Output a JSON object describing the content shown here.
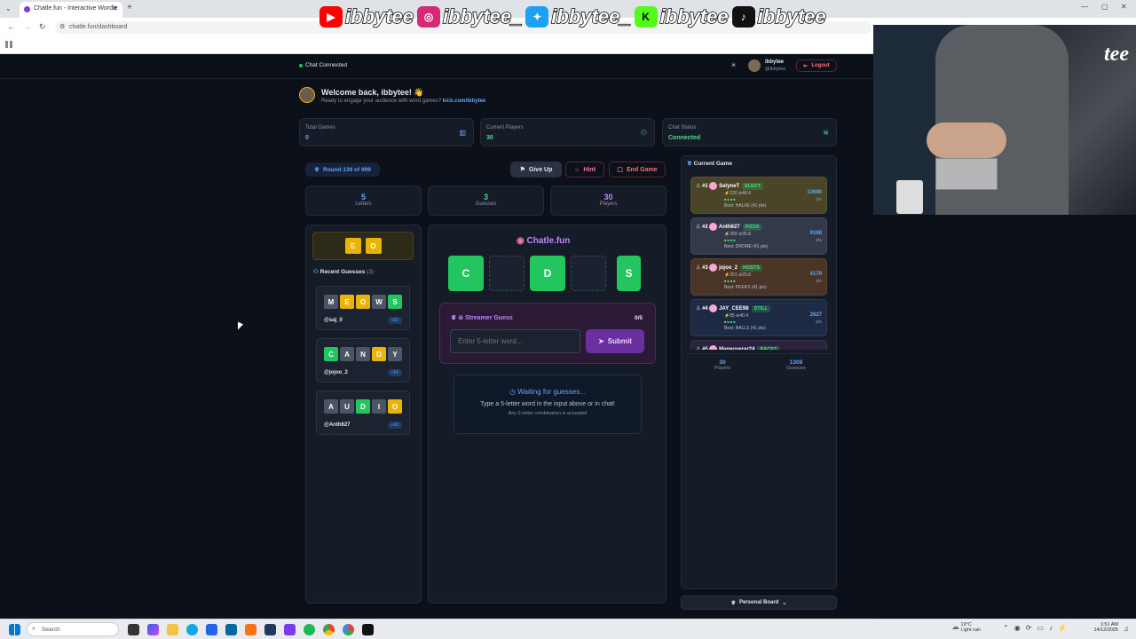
{
  "browser": {
    "tab_title": "Chatle.fun - Interactive Wordle",
    "url": "chatle.fun/dashboard"
  },
  "social": [
    {
      "icon": "youtube-icon",
      "handle": "ibbytee",
      "color": "#ff0000"
    },
    {
      "icon": "instagram-icon",
      "handle": "ibbytee_",
      "color": "#d62976"
    },
    {
      "icon": "twitter-icon",
      "handle": "ibbytee_",
      "color": "#1da1f2"
    },
    {
      "icon": "kick-icon",
      "handle": "ibbytee",
      "color": "#53fc18"
    },
    {
      "icon": "tiktok-icon",
      "handle": "ibbytee",
      "color": "#000000"
    }
  ],
  "webcam": {
    "overlay_text": "tee"
  },
  "header": {
    "chat_status": "Chat Connected",
    "user_name": "ibbytee",
    "user_handle": "@ibbytee",
    "logout_label": "Logout"
  },
  "welcome": {
    "title": "Welcome back, ibbytee! 👋",
    "subtitle": "Ready to engage your audience with word games?",
    "link": "kick.com/ibbytee"
  },
  "stats": [
    {
      "label": "Total Games",
      "value": "0",
      "color": "#60a5fa"
    },
    {
      "label": "Current Players",
      "value": "30",
      "color": "#4ade80"
    },
    {
      "label": "Chat Status",
      "value": "Connected",
      "color": "#4ade80"
    }
  ],
  "round": {
    "label": "Round 139 of 999"
  },
  "controls": {
    "give_up": "Give Up",
    "hint": "Hint",
    "end_game": "End Game"
  },
  "counters": [
    {
      "value": "5",
      "label": "Letters",
      "color": "#60a5fa"
    },
    {
      "value": "3",
      "label": "Guesses",
      "color": "#4ade80"
    },
    {
      "value": "30",
      "label": "Players",
      "color": "#c084fc"
    }
  ],
  "known_letters": [
    "E",
    "O"
  ],
  "recent_guesses": {
    "title": "Recent Guesses",
    "count": "(3)",
    "items": [
      {
        "letters": [
          [
            "M",
            "grey"
          ],
          [
            "E",
            "yellow"
          ],
          [
            "O",
            "yellow"
          ],
          [
            "W",
            "grey"
          ],
          [
            "S",
            "green"
          ]
        ],
        "user": "@saj_0",
        "pts": "+22"
      },
      {
        "letters": [
          [
            "C",
            "green"
          ],
          [
            "A",
            "grey"
          ],
          [
            "N",
            "grey"
          ],
          [
            "D",
            "yellow"
          ],
          [
            "Y",
            "grey"
          ]
        ],
        "user": "@jojoo_2",
        "pts": "+16"
      },
      {
        "letters": [
          [
            "A",
            "grey"
          ],
          [
            "U",
            "grey"
          ],
          [
            "D",
            "green"
          ],
          [
            "I",
            "grey"
          ],
          [
            "O",
            "yellow"
          ]
        ],
        "user": "@Anth627",
        "pts": "+16"
      }
    ]
  },
  "board": {
    "brand": "Chatle.fun",
    "tiles": [
      [
        "C",
        "green"
      ],
      [
        "",
        "empty"
      ],
      [
        "D",
        "green"
      ],
      [
        "",
        "empty"
      ],
      [
        "S",
        "green"
      ]
    ]
  },
  "streamer_guess": {
    "title": "Streamer Guess",
    "count": "0/5",
    "placeholder": "Enter 5-letter word...",
    "submit": "Submit"
  },
  "waiting": {
    "title": "Waiting for guesses...",
    "line1": "Type a 5-letter word in the input above or in chat!",
    "line2": "Any 5-letter combination is accepted"
  },
  "current_game": {
    "title": "Current Game",
    "leaderboard": [
      {
        "rank": "#1",
        "name": "SelyneT",
        "tag": "ELECT",
        "stats": "⚡220 ⊘40.4",
        "best": "Best: HALVE (41 pts)",
        "pts": "13686",
        "bg": "#4a4526",
        "tagcolor": "#22c55e"
      },
      {
        "rank": "#2",
        "name": "Anth627",
        "tag": "PIZZA",
        "stats": "⚡259 ⊘35.8",
        "best": "Best: DRONE (41 pts)",
        "pts": "9168",
        "bg": "#34394a",
        "tagcolor": "#22c55e"
      },
      {
        "rank": "#3",
        "name": "jojoo_2",
        "tag": "HOSTS",
        "stats": "⚡201 ⊘20.8",
        "best": "Best: PEEKS (41 pts)",
        "pts": "4179",
        "bg": "#4a3426",
        "tagcolor": "#22c55e"
      },
      {
        "rank": "#4",
        "name": "JAY_CEE98",
        "tag": "STILL",
        "stats": "⚡85 ⊘40.4",
        "best": "Best: BALLS (41 pts)",
        "pts": "2627",
        "bg": "#1e2a44",
        "tagcolor": "#22c55e"
      },
      {
        "rank": "#5",
        "name": "Maneuverer24",
        "tag": "RACES",
        "stats": "",
        "best": "",
        "pts": "",
        "bg": "#2a2340",
        "tagcolor": "#22c55e"
      }
    ],
    "pts_unit": "pts",
    "players_value": "30",
    "players_label": "Players",
    "guesses_value": "1308",
    "guesses_label": "Guesses"
  },
  "personal_board": "Personal Board",
  "taskbar": {
    "search": "Search",
    "weather": "19°C",
    "weather_desc": "Light rain",
    "time": "1:51 AM",
    "date": "14/12/2025"
  }
}
